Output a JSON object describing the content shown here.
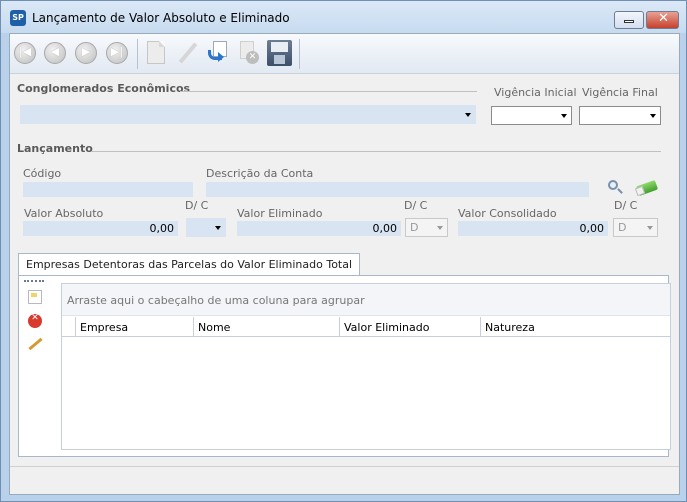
{
  "window": {
    "title": "Lançamento de Valor Absoluto e Eliminado",
    "app_icon_text": "SP"
  },
  "toolbar": {
    "buttons": [
      {
        "name": "first-record",
        "icon": "first-icon",
        "enabled": false
      },
      {
        "name": "previous-record",
        "icon": "previous-icon",
        "enabled": false
      },
      {
        "name": "next-record",
        "icon": "next-icon",
        "enabled": false
      },
      {
        "name": "last-record",
        "icon": "last-icon",
        "enabled": false
      },
      {
        "name": "new",
        "icon": "new-document-icon",
        "enabled": false
      },
      {
        "name": "edit",
        "icon": "pencil-icon",
        "enabled": false
      },
      {
        "name": "undo",
        "icon": "undo-icon",
        "enabled": true
      },
      {
        "name": "cancel",
        "icon": "cancel-icon",
        "enabled": false
      },
      {
        "name": "save",
        "icon": "save-icon",
        "enabled": true
      }
    ]
  },
  "conglomerados": {
    "section_title": "Conglomerados Econômicos",
    "selected": ""
  },
  "vigencia": {
    "inicial_label": "Vigência Inicial",
    "inicial_value": "",
    "final_label": "Vigência Final",
    "final_value": ""
  },
  "lancamento": {
    "section_title": "Lançamento",
    "codigo_label": "Código",
    "codigo_value": "",
    "descricao_label": "Descrição da Conta",
    "descricao_value": "",
    "valor_absoluto_label": "Valor Absoluto",
    "valor_absoluto_value": "0,00",
    "dc_label_1": "D/ C",
    "dc_value_1": "",
    "valor_eliminado_label": "Valor Eliminado",
    "valor_eliminado_value": "0,00",
    "dc_label_2": "D/ C",
    "dc_value_2": "D",
    "valor_consolidado_label": "Valor Consolidado",
    "valor_consolidado_value": "0,00",
    "dc_label_3": "D/ C",
    "dc_value_3": "D"
  },
  "tab": {
    "label": "Empresas Detentoras das Parcelas do Valor Eliminado Total"
  },
  "grid": {
    "group_hint": "Arraste aqui o cabeçalho de uma coluna para agrupar",
    "columns": [
      "Empresa",
      "Nome",
      "Valor Eliminado",
      "Natureza"
    ],
    "rows": []
  },
  "colors": {
    "field_bg": "#d8e4f2",
    "window_frame": "#b9d1ea"
  }
}
